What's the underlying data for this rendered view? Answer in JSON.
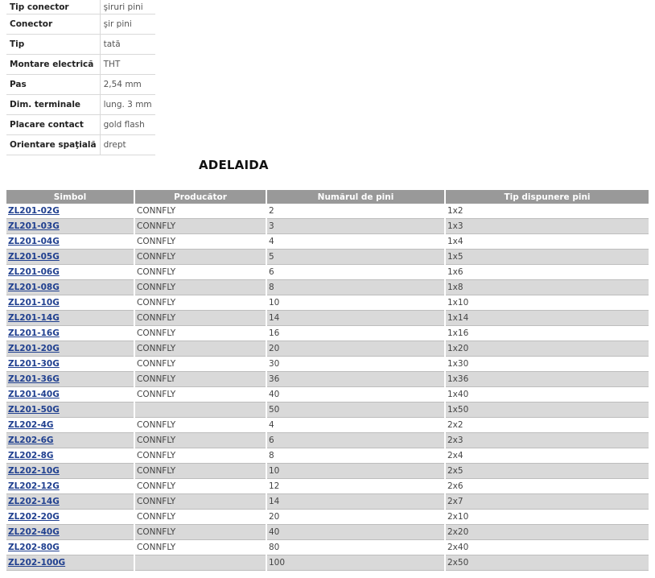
{
  "specs": [
    {
      "label": "Tip conector",
      "value": "şiruri pini"
    },
    {
      "label": "Conector",
      "value": "şir pini"
    },
    {
      "label": "Tip",
      "value": "tată"
    },
    {
      "label": "Montare electrică",
      "value": "THT"
    },
    {
      "label": "Pas",
      "value": "2,54 mm"
    },
    {
      "label": "Dim. terminale",
      "value": "lung. 3 mm"
    },
    {
      "label": "Placare contact",
      "value": "gold flash"
    },
    {
      "label": "Orientare spaţială",
      "value": "drept"
    }
  ],
  "section_title": "ADELAIDA",
  "table": {
    "headers": [
      "Simbol",
      "Producător",
      "Numărul de pini",
      "Tip dispunere pini"
    ],
    "rows": [
      {
        "symbol": "ZL201-02G",
        "producer": "CONNFLY",
        "pins": "2",
        "layout": "1x2"
      },
      {
        "symbol": "ZL201-03G",
        "producer": "CONNFLY",
        "pins": "3",
        "layout": "1x3"
      },
      {
        "symbol": "ZL201-04G",
        "producer": "CONNFLY",
        "pins": "4",
        "layout": "1x4"
      },
      {
        "symbol": "ZL201-05G",
        "producer": "CONNFLY",
        "pins": "5",
        "layout": "1x5"
      },
      {
        "symbol": "ZL201-06G",
        "producer": "CONNFLY",
        "pins": "6",
        "layout": "1x6"
      },
      {
        "symbol": "ZL201-08G",
        "producer": "CONNFLY",
        "pins": "8",
        "layout": "1x8"
      },
      {
        "symbol": "ZL201-10G",
        "producer": "CONNFLY",
        "pins": "10",
        "layout": "1x10"
      },
      {
        "symbol": "ZL201-14G",
        "producer": "CONNFLY",
        "pins": "14",
        "layout": "1x14"
      },
      {
        "symbol": "ZL201-16G",
        "producer": "CONNFLY",
        "pins": "16",
        "layout": "1x16"
      },
      {
        "symbol": "ZL201-20G",
        "producer": "CONNFLY",
        "pins": "20",
        "layout": "1x20"
      },
      {
        "symbol": "ZL201-30G",
        "producer": "CONNFLY",
        "pins": "30",
        "layout": "1x30"
      },
      {
        "symbol": "ZL201-36G",
        "producer": "CONNFLY",
        "pins": "36",
        "layout": "1x36"
      },
      {
        "symbol": "ZL201-40G",
        "producer": "CONNFLY",
        "pins": "40",
        "layout": "1x40"
      },
      {
        "symbol": "ZL201-50G",
        "producer": "",
        "pins": "50",
        "layout": "1x50"
      },
      {
        "symbol": "ZL202-4G",
        "producer": "CONNFLY",
        "pins": "4",
        "layout": "2x2"
      },
      {
        "symbol": "ZL202-6G",
        "producer": "CONNFLY",
        "pins": "6",
        "layout": "2x3"
      },
      {
        "symbol": "ZL202-8G",
        "producer": "CONNFLY",
        "pins": "8",
        "layout": "2x4"
      },
      {
        "symbol": "ZL202-10G",
        "producer": "CONNFLY",
        "pins": "10",
        "layout": "2x5"
      },
      {
        "symbol": "ZL202-12G",
        "producer": "CONNFLY",
        "pins": "12",
        "layout": "2x6"
      },
      {
        "symbol": "ZL202-14G",
        "producer": "CONNFLY",
        "pins": "14",
        "layout": "2x7"
      },
      {
        "symbol": "ZL202-20G",
        "producer": "CONNFLY",
        "pins": "20",
        "layout": "2x10"
      },
      {
        "symbol": "ZL202-40G",
        "producer": "CONNFLY",
        "pins": "40",
        "layout": "2x20"
      },
      {
        "symbol": "ZL202-80G",
        "producer": "CONNFLY",
        "pins": "80",
        "layout": "2x40"
      },
      {
        "symbol": "ZL202-100G",
        "producer": "",
        "pins": "100",
        "layout": "2x50"
      }
    ]
  }
}
